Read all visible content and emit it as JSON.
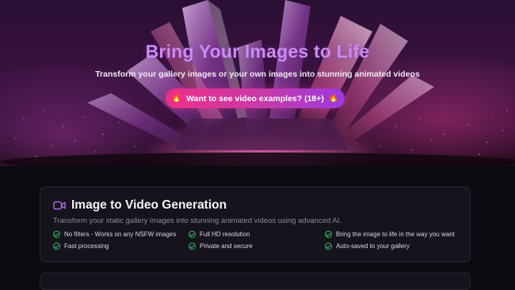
{
  "hero": {
    "title": "Bring Your Images to Life",
    "subtitle": "Transform your gallery images or your own images into stunning animated videos",
    "cta_label": "Want to see video examples? (18+)",
    "cta_icon_left": "🔥",
    "cta_icon_right": "🔥"
  },
  "card": {
    "icon": "video-camera-icon",
    "title": "Image to Video Generation",
    "description": "Transform your static gallery images into stunning animated videos using advanced AI.",
    "features": [
      "No filters - Works on any NSFW images",
      "Full HD resolution",
      "Bring the image to life in the way you want",
      "Fast processing",
      "Private and secure",
      "Auto-saved to your gallery"
    ]
  },
  "colors": {
    "accent_purple": "#b06df0",
    "cta_pink": "#ee2f86",
    "check_green": "#34c06a",
    "background": "#0b0a10"
  }
}
